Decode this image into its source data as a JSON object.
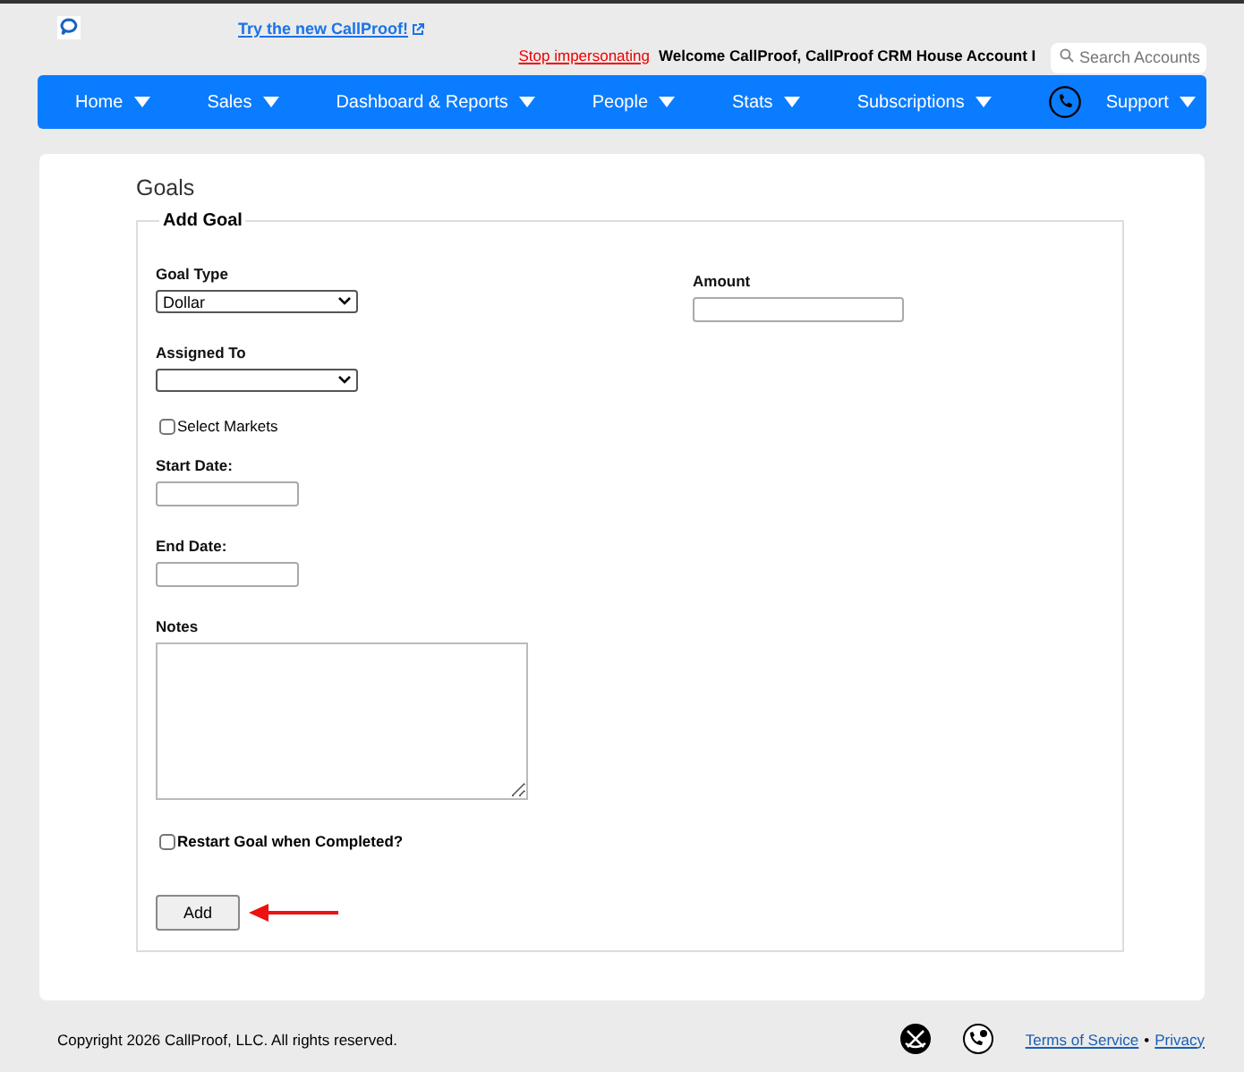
{
  "header": {
    "promo_link": "Try the new CallProof!",
    "stop_link": "Stop impersonating",
    "welcome": "Welcome CallProof, CallProof CRM House Account I",
    "search": {
      "placeholder": "Search Accounts"
    }
  },
  "nav": {
    "items": [
      {
        "label": "Home"
      },
      {
        "label": "Sales"
      },
      {
        "label": "Dashboard & Reports"
      },
      {
        "label": "People"
      },
      {
        "label": "Stats"
      },
      {
        "label": "Subscriptions"
      },
      {
        "label": "Support"
      }
    ]
  },
  "page": {
    "title": "Goals",
    "legend": "Add Goal",
    "goal_type": {
      "label": "Goal Type",
      "value": "Dollar"
    },
    "amount": {
      "label": "Amount"
    },
    "assigned_to": {
      "label": "Assigned To"
    },
    "select_markets": {
      "label": "Select Markets",
      "checked": false
    },
    "start_date": {
      "label": "Start Date:"
    },
    "end_date": {
      "label": "End Date:"
    },
    "notes": {
      "label": "Notes"
    },
    "restart": {
      "label": "Restart Goal when Completed?",
      "checked": false
    },
    "add_button": "Add"
  },
  "footer": {
    "copyright": "Copyright 2026 CallProof, LLC. All rights reserved.",
    "links": [
      "Terms of Service",
      "Privacy"
    ],
    "separator": "•"
  }
}
